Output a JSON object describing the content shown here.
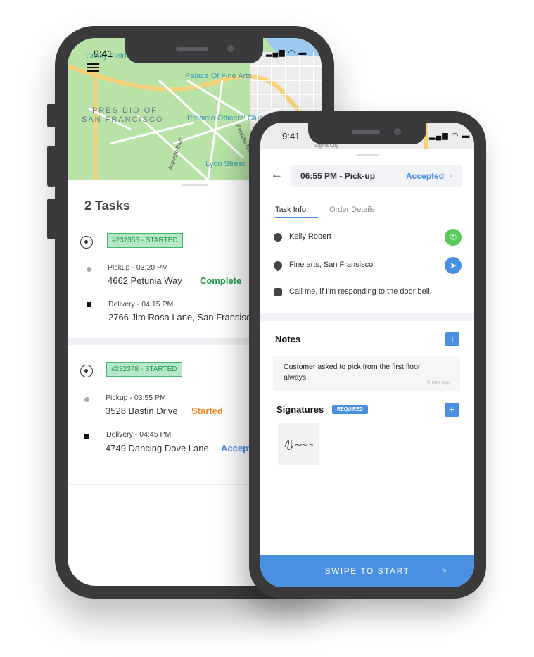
{
  "back_phone": {
    "status_time": "9:41",
    "map": {
      "labels": [
        "Crissy Field",
        "Palace Of Fine Arts",
        "PRESIDIO OF",
        "SAN FRANCISCO",
        "Presidio Officers' Club",
        "Arguello Blvd",
        "Presidio Blvd",
        "Lyon Street"
      ]
    },
    "title": "2 Tasks",
    "tasks": [
      {
        "badge": "#232356 - STARTED",
        "pickup_label": "Pickup - 03:20 PM",
        "pickup_address": "4662  Petunia Way",
        "pickup_status": "Complete",
        "delivery_label": "Delivery - 04:15 PM",
        "delivery_address": "2766  Jim Rosa Lane, San Fransisco"
      },
      {
        "badge": "#232378 - STARTED",
        "pickup_label": "Pickup - 03:55 PM",
        "pickup_address": "3528  Bastin Drive",
        "pickup_status": "Started",
        "delivery_label": "Delivery - 04:45 PM",
        "delivery_address": "4749  Dancing Dove Lane",
        "delivery_status": "Accepted"
      }
    ]
  },
  "front_phone": {
    "status_time": "9:41",
    "map_label": "Sigma City",
    "header": {
      "title": "06:55 PM - Pick-up",
      "status": "Accepted"
    },
    "tabs": [
      {
        "label": "Task Info",
        "active": true
      },
      {
        "label": "Order Details",
        "active": false
      }
    ],
    "info": {
      "name": "Kelly Robert",
      "address": "Fine arts, San Fransisco",
      "note": "Call me, if I'm responding to the door bell."
    },
    "notes": {
      "title": "Notes",
      "add": "+",
      "items": [
        {
          "text": "Customer asked to pick from the first floor always.",
          "time": "4 min ago"
        }
      ]
    },
    "signatures": {
      "title": "Signatures",
      "badge": "REQUIRED",
      "add": "+"
    },
    "swipe": {
      "label": "SWIPE TO START",
      "arrow": ">"
    }
  },
  "colors": {
    "accent": "#4a90e2",
    "green": "#1f9a4a",
    "orange": "#f5891f",
    "call": "#5bc85b"
  }
}
